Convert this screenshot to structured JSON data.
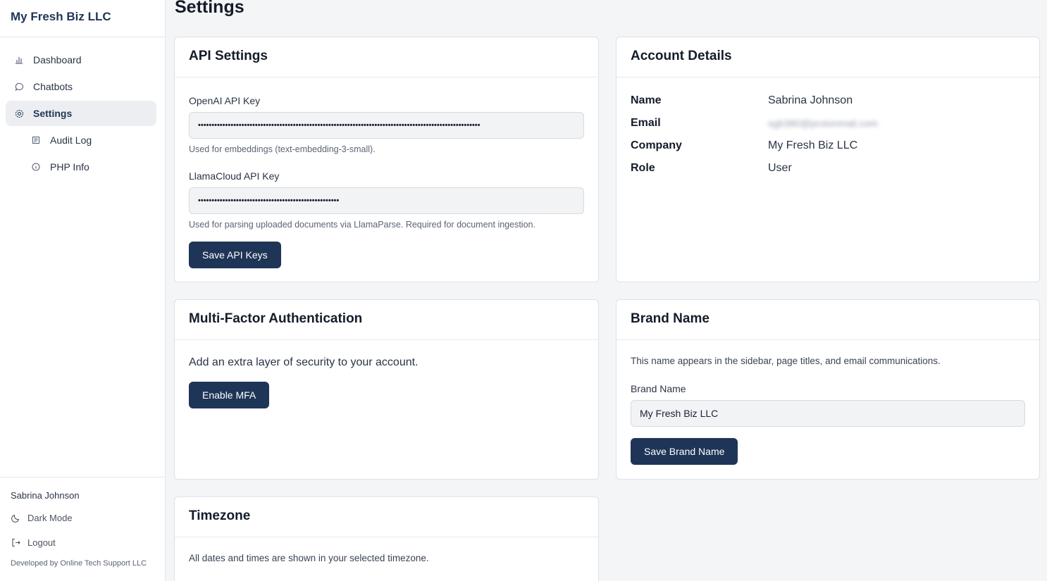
{
  "sidebar": {
    "brand": "My Fresh Biz LLC",
    "items": [
      {
        "label": "Dashboard",
        "icon": "bar-chart-icon"
      },
      {
        "label": "Chatbots",
        "icon": "chat-bubble-icon"
      },
      {
        "label": "Settings",
        "icon": "gear-icon",
        "active": true
      },
      {
        "label": "Audit Log",
        "icon": "log-icon"
      },
      {
        "label": "PHP Info",
        "icon": "info-icon"
      }
    ],
    "footer": {
      "user": "Sabrina Johnson",
      "dark_mode": "Dark Mode",
      "logout": "Logout",
      "credit": "Developed by Online Tech Support LLC"
    }
  },
  "page": {
    "title": "Settings"
  },
  "api_settings": {
    "title": "API Settings",
    "openai_label": "OpenAI API Key",
    "openai_value": "••••••••••••••••••••••••••••••••••••••••••••••••••••••••••••••••••••••••••••••••••••••••••••••••••••••••",
    "openai_help": "Used for embeddings (text-embedding-3-small).",
    "llama_label": "LlamaCloud API Key",
    "llama_value": "••••••••••••••••••••••••••••••••••••••••••••••••••••",
    "llama_help": "Used for parsing uploaded documents via LlamaParse. Required for document ingestion.",
    "save_label": "Save API Keys"
  },
  "account": {
    "title": "Account Details",
    "rows": [
      {
        "key": "Name",
        "value": "Sabrina Johnson"
      },
      {
        "key": "Email",
        "value": "sgb380@protonmail.com"
      },
      {
        "key": "Company",
        "value": "My Fresh Biz LLC"
      },
      {
        "key": "Role",
        "value": "User"
      }
    ]
  },
  "mfa": {
    "title": "Multi-Factor Authentication",
    "description": "Add an extra layer of security to your account.",
    "button": "Enable MFA"
  },
  "brand": {
    "title": "Brand Name",
    "description": "This name appears in the sidebar, page titles, and email communications.",
    "label": "Brand Name",
    "value": "My Fresh Biz LLC",
    "button": "Save Brand Name"
  },
  "timezone": {
    "title": "Timezone",
    "description": "All dates and times are shown in your selected timezone."
  }
}
